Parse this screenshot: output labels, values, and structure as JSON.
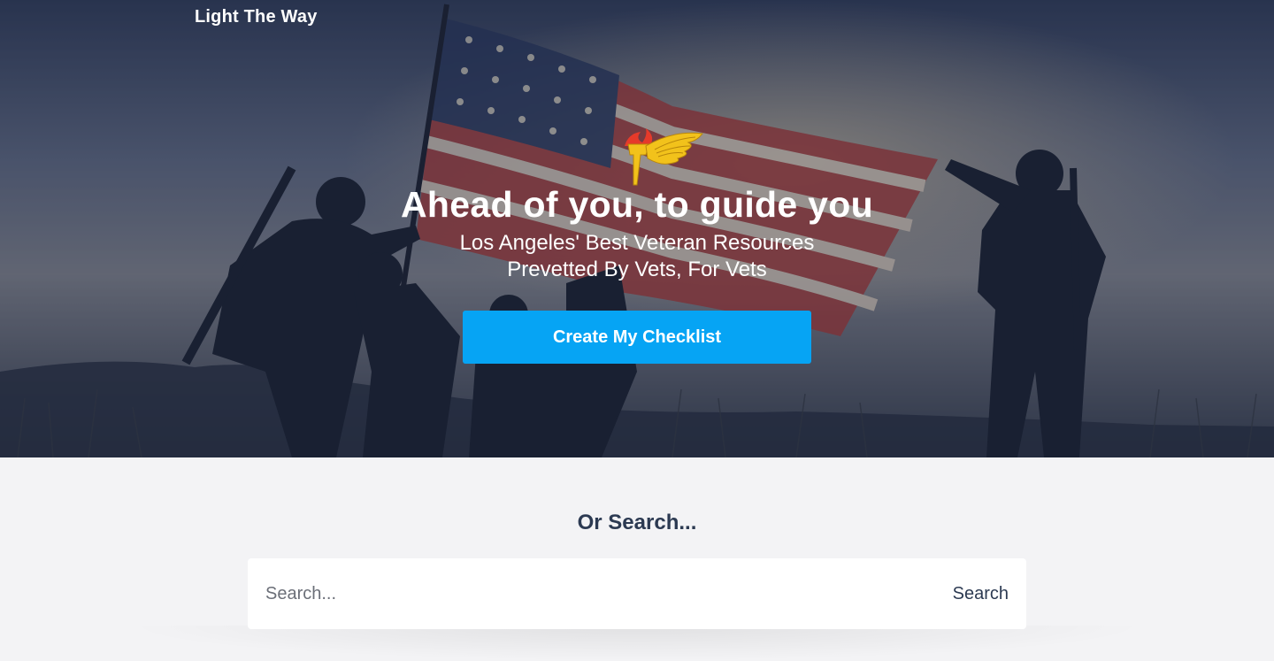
{
  "header": {
    "brand": "Light The Way"
  },
  "hero": {
    "headline": "Ahead of you, to guide you",
    "subline_1": "Los Angeles' Best Veteran Resources",
    "subline_2": "Prevetted By Vets, For Vets",
    "cta_label": "Create My Checklist",
    "insignia_icon": "pathfinder-torch-wing-icon",
    "background_image": "soldiers-raising-flag-silhouette"
  },
  "search": {
    "heading": "Or Search...",
    "placeholder": "Search...",
    "button_label": "Search"
  },
  "colors": {
    "accent": "#06a4f4",
    "heading_text": "#2c3a52",
    "section_bg": "#f3f3f5"
  }
}
